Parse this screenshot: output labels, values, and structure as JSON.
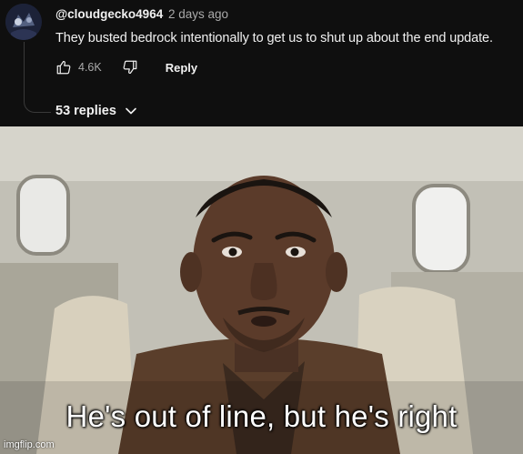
{
  "comment": {
    "username": "@cloudgecko4964",
    "timestamp": "2 days ago",
    "text": "They busted bedrock intentionally to get us to shut up about the end update.",
    "like_count": "4.6K",
    "reply_label": "Reply",
    "replies_label": "53 replies"
  },
  "icons": {
    "avatar": "avatar",
    "like": "thumbs-up-icon",
    "dislike": "thumbs-down-icon",
    "replies_toggle": "chevron-down-icon"
  },
  "colors": {
    "panel_background": "#0f0f0f",
    "primary_text": "#f1f1f1",
    "secondary_text": "#aaaaaa"
  },
  "meme": {
    "caption": "He's out of line, but he's right",
    "watermark": "imgflip.com"
  }
}
